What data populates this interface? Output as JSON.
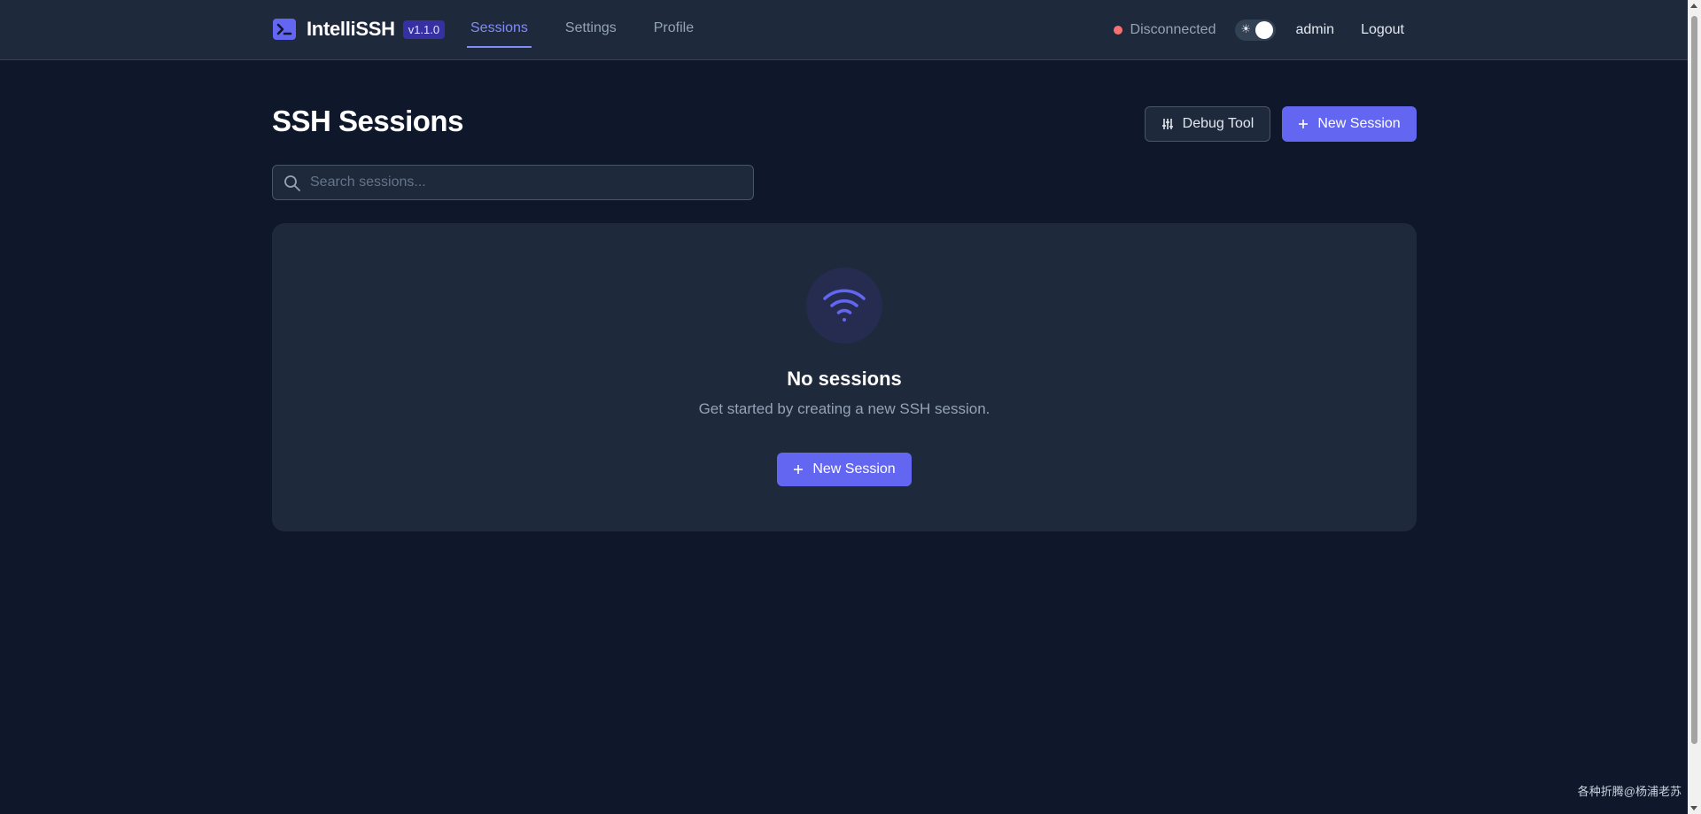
{
  "app": {
    "name": "IntelliSSH",
    "version": "v1.1.0"
  },
  "nav": {
    "links": [
      {
        "label": "Sessions",
        "active": true
      },
      {
        "label": "Settings",
        "active": false
      },
      {
        "label": "Profile",
        "active": false
      }
    ]
  },
  "header_right": {
    "status": "Disconnected",
    "status_color": "#f87171",
    "theme_toggle_icon": "sun-icon",
    "username": "admin",
    "logout": "Logout"
  },
  "main": {
    "title": "SSH Sessions",
    "debug_button": "Debug Tool",
    "new_session_button": "New Session",
    "search": {
      "placeholder": "Search sessions...",
      "value": ""
    }
  },
  "empty_state": {
    "icon": "wifi-icon",
    "title": "No sessions",
    "subtitle": "Get started by creating a new SSH session.",
    "button": "New Session"
  },
  "watermark": "各种折腾@杨浦老苏",
  "colors": {
    "accent": "#6366f1",
    "background": "#0f172a",
    "surface": "#1e293b"
  }
}
